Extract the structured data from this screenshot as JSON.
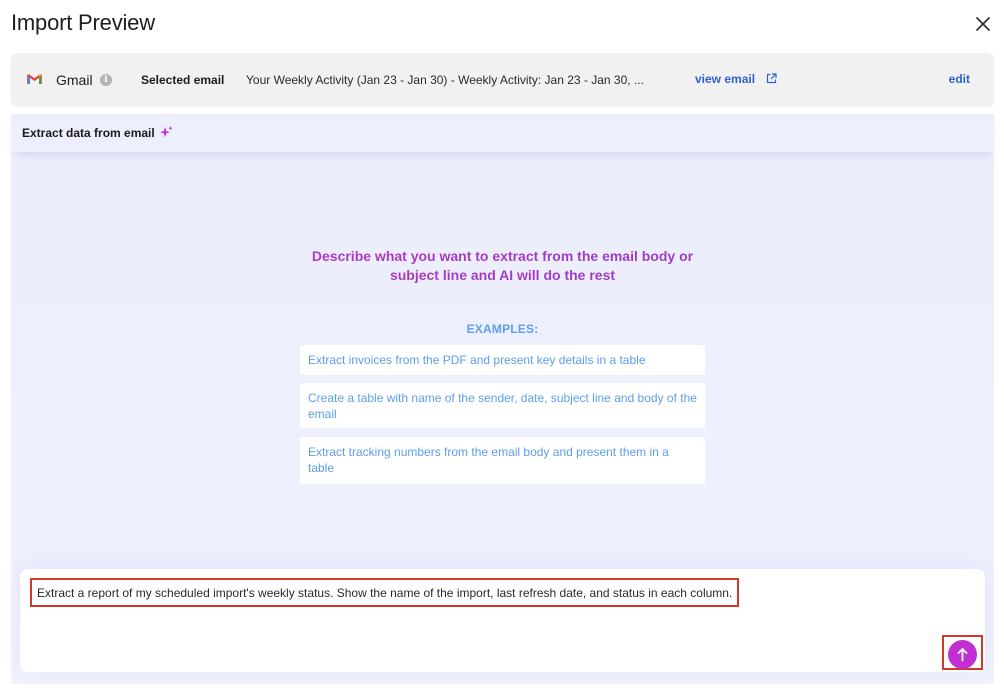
{
  "header": {
    "title": "Import Preview",
    "close_icon": "close-icon"
  },
  "email_bar": {
    "source_name": "Gmail",
    "source_icon": "gmail-logo-icon",
    "info_icon": "info-icon",
    "selected_label": "Selected email",
    "subject": "Your Weekly Activity (Jan 23 - Jan 30) - Weekly Activity: Jan 23 - Jan 30, ...",
    "view_email_label": "view email",
    "view_email_icon": "external-link-icon",
    "edit_label": "edit"
  },
  "extract": {
    "title": "Extract data from email",
    "title_icon": "sparkle-icon",
    "headline_line1": "Describe what you want to extract from the email body or",
    "headline_line2": "subject line and AI will do the rest",
    "examples_label": "EXAMPLES:",
    "examples": [
      "Extract invoices from the PDF and present key details in a table",
      "Create a table with name of the sender, date, subject line and body of the email",
      "Extract tracking numbers from the email body and present them in a table"
    ],
    "prompt_value": "Extract a report of my scheduled import's weekly status. Show the name of the import, last refresh date, and status in each column.",
    "send_icon": "arrow-up-icon"
  },
  "colors": {
    "accent_link": "#2f5fd8",
    "example_text": "#5c9eea",
    "send_button": "#c12fd2",
    "highlight_border": "#d2392b",
    "panel_bg": "#eeeffd"
  }
}
